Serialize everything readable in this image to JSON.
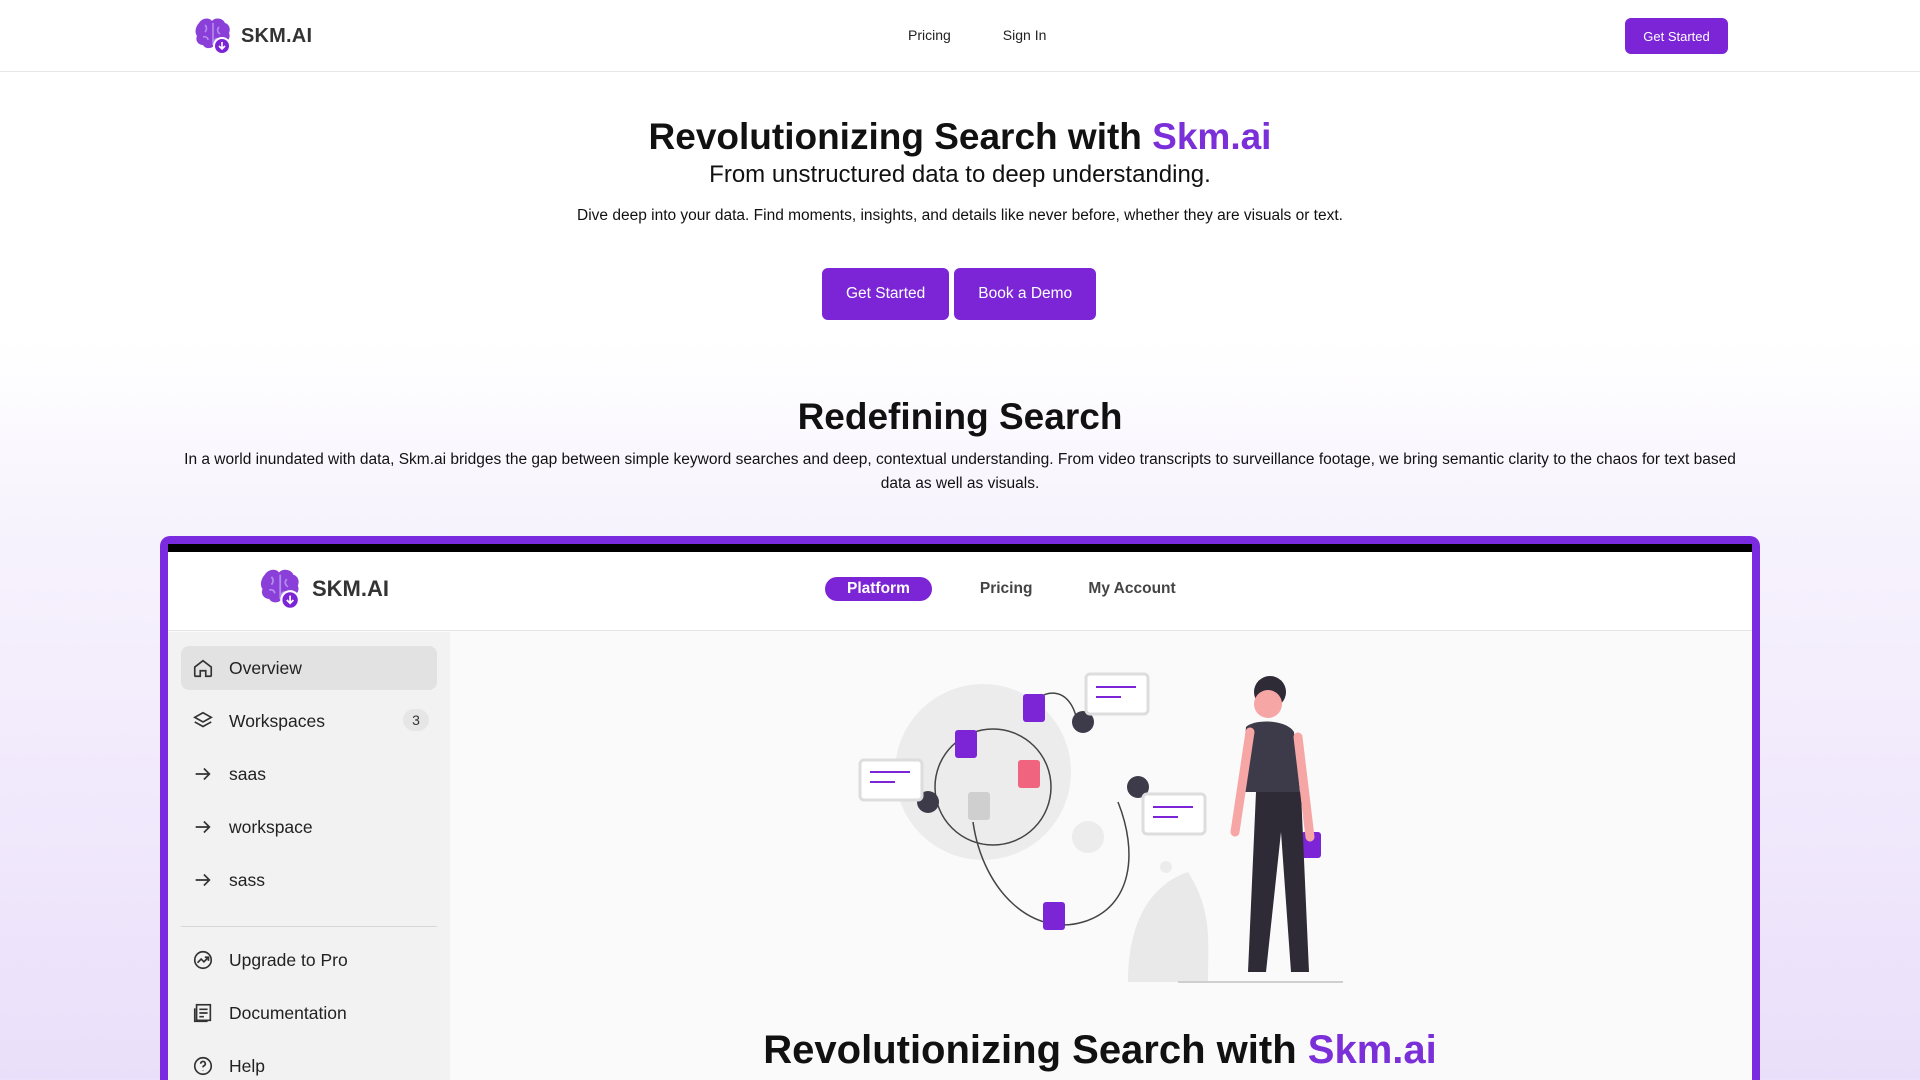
{
  "nav": {
    "brand": "SKM.AI",
    "links": [
      "Pricing",
      "Sign In"
    ],
    "cta": "Get Started"
  },
  "hero": {
    "title_prefix": "Revolutionizing Search with ",
    "title_accent": "Skm.ai",
    "subtitle": "From unstructured data to deep understanding.",
    "description": "Dive deep into your data. Find moments, insights, and details like never before, whether they are visuals or text.",
    "primary_button": "Get Started",
    "secondary_button": "Book a Demo"
  },
  "section": {
    "title": "Redefining Search",
    "description": "In a world inundated with data, Skm.ai bridges the gap between simple keyword searches and deep, contextual understanding. From video transcripts to surveillance footage, we bring semantic clarity to the chaos for text based data as well as visuals."
  },
  "app_preview": {
    "brand": "SKM.AI",
    "tabs": [
      "Platform",
      "Pricing",
      "My Account"
    ],
    "active_tab": "Platform",
    "sidebar": [
      {
        "label": "Overview",
        "icon": "home-icon",
        "active": true
      },
      {
        "label": "Workspaces",
        "icon": "layers-icon",
        "badge": "3"
      },
      {
        "label": "saas",
        "icon": "arrow-right-icon"
      },
      {
        "label": "workspace",
        "icon": "arrow-right-icon"
      },
      {
        "label": "sass",
        "icon": "arrow-right-icon"
      }
    ],
    "sidebar_bottom": [
      {
        "label": "Upgrade to Pro",
        "icon": "trend-icon"
      },
      {
        "label": "Documentation",
        "icon": "document-icon"
      },
      {
        "label": "Help",
        "icon": "help-icon"
      }
    ],
    "hero_title_prefix": "Revolutionizing Search with ",
    "hero_title_accent": "Skm.ai"
  },
  "colors": {
    "accent": "#7b25d6",
    "accent_text": "#7b2fd9",
    "illustration_pink": "#f06480"
  }
}
